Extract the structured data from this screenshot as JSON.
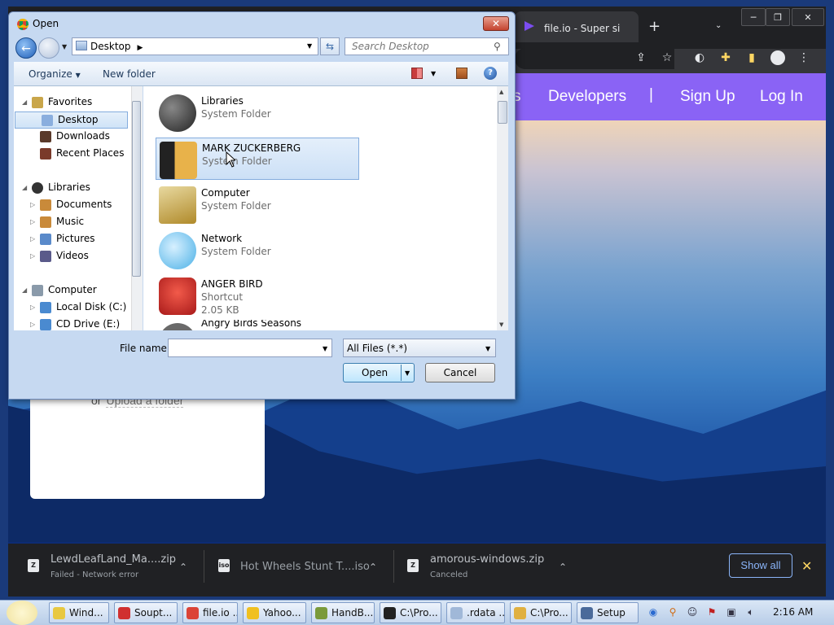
{
  "browser": {
    "tab_title": "file.io - Super si",
    "site_nav": [
      "s",
      "Developers",
      "|",
      "Sign Up",
      "Log In"
    ],
    "upload_or": "or",
    "upload_folder_link": "Upload a folder",
    "downloads": [
      {
        "name": "LewdLeafLand_Ma....zip",
        "status": "Failed - Network error",
        "icon": "zip"
      },
      {
        "name": "Hot Wheels Stunt T....iso",
        "status": "",
        "icon": "iso"
      },
      {
        "name": "amorous-windows.zip",
        "status": "Canceled",
        "icon": "zip"
      }
    ],
    "show_all": "Show all"
  },
  "dialog": {
    "title": "Open",
    "address": "Desktop",
    "search_placeholder": "Search Desktop",
    "organize": "Organize",
    "new_folder": "New folder",
    "nav": [
      {
        "label": "Favorites",
        "level": 0,
        "expanded": true,
        "icon": "star-icon",
        "color": "#c9a64a"
      },
      {
        "label": "Desktop",
        "level": 1,
        "selected": true,
        "icon": "desktop-icon",
        "color": "#8aaede"
      },
      {
        "label": "Downloads",
        "level": 1,
        "icon": "downloads-icon",
        "color": "#5a3a2a"
      },
      {
        "label": "Recent Places",
        "level": 1,
        "icon": "recent-places-icon",
        "color": "#7a3a2a"
      },
      {
        "label": "",
        "level": 0,
        "spacer": true
      },
      {
        "label": "Libraries",
        "level": 0,
        "expanded": true,
        "icon": "libraries-icon",
        "color": "#333333"
      },
      {
        "label": "Documents",
        "level": 1,
        "collapsed": true,
        "icon": "documents-icon",
        "color": "#c98a3a"
      },
      {
        "label": "Music",
        "level": 1,
        "collapsed": true,
        "icon": "music-icon",
        "color": "#c98a3a"
      },
      {
        "label": "Pictures",
        "level": 1,
        "collapsed": true,
        "icon": "pictures-icon",
        "color": "#5a8aca"
      },
      {
        "label": "Videos",
        "level": 1,
        "collapsed": true,
        "icon": "videos-icon",
        "color": "#5a5a8a"
      },
      {
        "label": "",
        "level": 0,
        "spacer": true
      },
      {
        "label": "Computer",
        "level": 0,
        "expanded": true,
        "icon": "computer-icon",
        "color": "#8a9aaa"
      },
      {
        "label": "Local Disk (C:)",
        "level": 1,
        "collapsed": true,
        "icon": "local-disk-icon",
        "color": "#4a8ad0"
      },
      {
        "label": "CD Drive (E:)",
        "level": 1,
        "collapsed": true,
        "icon": "cd-drive-icon",
        "color": "#4a8ad0"
      }
    ],
    "files": [
      {
        "name": "Libraries",
        "type": "System Folder",
        "size": "",
        "icon": "libraries-icon",
        "color": "#444444"
      },
      {
        "name": "MARK ZUCKERBERG",
        "type": "System Folder",
        "size": "",
        "icon": "user-folder-icon",
        "color": "#d9a441",
        "selected": true
      },
      {
        "name": "Computer",
        "type": "System Folder",
        "size": "",
        "icon": "computer-icon",
        "color": "#c7a236"
      },
      {
        "name": "Network",
        "type": "System Folder",
        "size": "",
        "icon": "network-icon",
        "color": "#7ec8ef"
      },
      {
        "name": "ANGER BIRD",
        "type": "Shortcut",
        "size": "2.05 KB",
        "icon": "angry-birds-icon",
        "color": "#d63a2a"
      },
      {
        "name": "Angry Birds Seasons",
        "type": "",
        "size": "",
        "icon": "angry-birds-seasons-icon",
        "color": "#6a6a6a"
      }
    ],
    "file_name_label": "File name:",
    "file_name_value": "",
    "filter": "All Files (*.*)",
    "open": "Open",
    "cancel": "Cancel"
  },
  "taskbar": {
    "tasks": [
      {
        "label": "Wind...",
        "color": "#e8c840"
      },
      {
        "label": "Soupt...",
        "color": "#d03030"
      },
      {
        "label": "file.io ...",
        "color": "#db4437"
      },
      {
        "label": "Yahoo...",
        "color": "#f0c020"
      },
      {
        "label": "HandB...",
        "color": "#7a9a3a"
      },
      {
        "label": "C:\\Pro...",
        "color": "#222222"
      },
      {
        "label": ".rdata ...",
        "color": "#a0b8d8"
      },
      {
        "label": "C:\\Pro...",
        "color": "#e0b040"
      },
      {
        "label": "Setup",
        "color": "#4a6a9a"
      }
    ],
    "clock": "2:16 AM"
  }
}
